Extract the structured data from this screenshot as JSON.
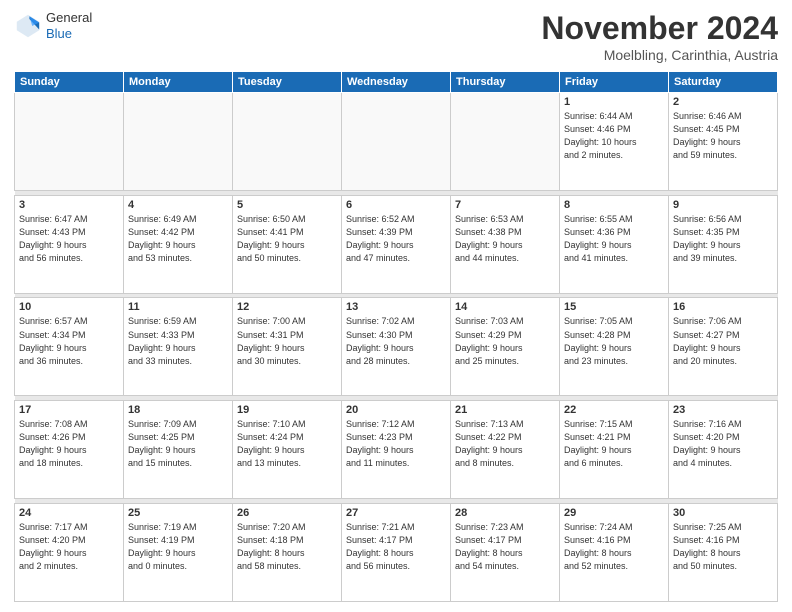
{
  "logo": {
    "general": "General",
    "blue": "Blue"
  },
  "header": {
    "month": "November 2024",
    "location": "Moelbling, Carinthia, Austria"
  },
  "weekdays": [
    "Sunday",
    "Monday",
    "Tuesday",
    "Wednesday",
    "Thursday",
    "Friday",
    "Saturday"
  ],
  "weeks": [
    [
      {
        "day": "",
        "info": ""
      },
      {
        "day": "",
        "info": ""
      },
      {
        "day": "",
        "info": ""
      },
      {
        "day": "",
        "info": ""
      },
      {
        "day": "",
        "info": ""
      },
      {
        "day": "1",
        "info": "Sunrise: 6:44 AM\nSunset: 4:46 PM\nDaylight: 10 hours\nand 2 minutes."
      },
      {
        "day": "2",
        "info": "Sunrise: 6:46 AM\nSunset: 4:45 PM\nDaylight: 9 hours\nand 59 minutes."
      }
    ],
    [
      {
        "day": "3",
        "info": "Sunrise: 6:47 AM\nSunset: 4:43 PM\nDaylight: 9 hours\nand 56 minutes."
      },
      {
        "day": "4",
        "info": "Sunrise: 6:49 AM\nSunset: 4:42 PM\nDaylight: 9 hours\nand 53 minutes."
      },
      {
        "day": "5",
        "info": "Sunrise: 6:50 AM\nSunset: 4:41 PM\nDaylight: 9 hours\nand 50 minutes."
      },
      {
        "day": "6",
        "info": "Sunrise: 6:52 AM\nSunset: 4:39 PM\nDaylight: 9 hours\nand 47 minutes."
      },
      {
        "day": "7",
        "info": "Sunrise: 6:53 AM\nSunset: 4:38 PM\nDaylight: 9 hours\nand 44 minutes."
      },
      {
        "day": "8",
        "info": "Sunrise: 6:55 AM\nSunset: 4:36 PM\nDaylight: 9 hours\nand 41 minutes."
      },
      {
        "day": "9",
        "info": "Sunrise: 6:56 AM\nSunset: 4:35 PM\nDaylight: 9 hours\nand 39 minutes."
      }
    ],
    [
      {
        "day": "10",
        "info": "Sunrise: 6:57 AM\nSunset: 4:34 PM\nDaylight: 9 hours\nand 36 minutes."
      },
      {
        "day": "11",
        "info": "Sunrise: 6:59 AM\nSunset: 4:33 PM\nDaylight: 9 hours\nand 33 minutes."
      },
      {
        "day": "12",
        "info": "Sunrise: 7:00 AM\nSunset: 4:31 PM\nDaylight: 9 hours\nand 30 minutes."
      },
      {
        "day": "13",
        "info": "Sunrise: 7:02 AM\nSunset: 4:30 PM\nDaylight: 9 hours\nand 28 minutes."
      },
      {
        "day": "14",
        "info": "Sunrise: 7:03 AM\nSunset: 4:29 PM\nDaylight: 9 hours\nand 25 minutes."
      },
      {
        "day": "15",
        "info": "Sunrise: 7:05 AM\nSunset: 4:28 PM\nDaylight: 9 hours\nand 23 minutes."
      },
      {
        "day": "16",
        "info": "Sunrise: 7:06 AM\nSunset: 4:27 PM\nDaylight: 9 hours\nand 20 minutes."
      }
    ],
    [
      {
        "day": "17",
        "info": "Sunrise: 7:08 AM\nSunset: 4:26 PM\nDaylight: 9 hours\nand 18 minutes."
      },
      {
        "day": "18",
        "info": "Sunrise: 7:09 AM\nSunset: 4:25 PM\nDaylight: 9 hours\nand 15 minutes."
      },
      {
        "day": "19",
        "info": "Sunrise: 7:10 AM\nSunset: 4:24 PM\nDaylight: 9 hours\nand 13 minutes."
      },
      {
        "day": "20",
        "info": "Sunrise: 7:12 AM\nSunset: 4:23 PM\nDaylight: 9 hours\nand 11 minutes."
      },
      {
        "day": "21",
        "info": "Sunrise: 7:13 AM\nSunset: 4:22 PM\nDaylight: 9 hours\nand 8 minutes."
      },
      {
        "day": "22",
        "info": "Sunrise: 7:15 AM\nSunset: 4:21 PM\nDaylight: 9 hours\nand 6 minutes."
      },
      {
        "day": "23",
        "info": "Sunrise: 7:16 AM\nSunset: 4:20 PM\nDaylight: 9 hours\nand 4 minutes."
      }
    ],
    [
      {
        "day": "24",
        "info": "Sunrise: 7:17 AM\nSunset: 4:20 PM\nDaylight: 9 hours\nand 2 minutes."
      },
      {
        "day": "25",
        "info": "Sunrise: 7:19 AM\nSunset: 4:19 PM\nDaylight: 9 hours\nand 0 minutes."
      },
      {
        "day": "26",
        "info": "Sunrise: 7:20 AM\nSunset: 4:18 PM\nDaylight: 8 hours\nand 58 minutes."
      },
      {
        "day": "27",
        "info": "Sunrise: 7:21 AM\nSunset: 4:17 PM\nDaylight: 8 hours\nand 56 minutes."
      },
      {
        "day": "28",
        "info": "Sunrise: 7:23 AM\nSunset: 4:17 PM\nDaylight: 8 hours\nand 54 minutes."
      },
      {
        "day": "29",
        "info": "Sunrise: 7:24 AM\nSunset: 4:16 PM\nDaylight: 8 hours\nand 52 minutes."
      },
      {
        "day": "30",
        "info": "Sunrise: 7:25 AM\nSunset: 4:16 PM\nDaylight: 8 hours\nand 50 minutes."
      }
    ]
  ]
}
